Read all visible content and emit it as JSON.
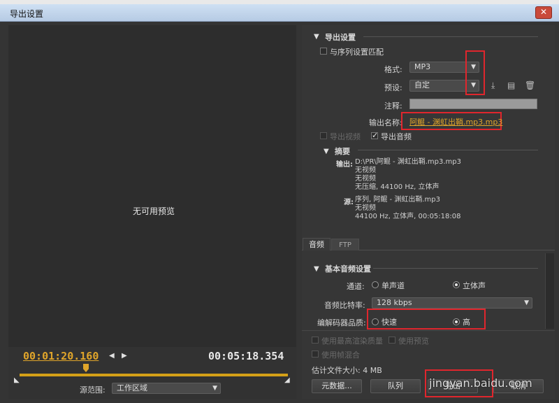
{
  "window": {
    "title": "导出设置",
    "close_glyph": "✕"
  },
  "preview": {
    "no_preview": "无可用预览"
  },
  "timeline": {
    "in_time": "00:01:20.160",
    "out_time": "00:05:18.354",
    "in_pos_fraction": 0.25
  },
  "source_range": {
    "label": "源范围:",
    "value": "工作区域"
  },
  "export": {
    "section_title": "导出设置",
    "match_seq": "与序列设置匹配",
    "format_label": "格式:",
    "format_value": "MP3",
    "preset_label": "预设:",
    "preset_value": "自定",
    "comment_label": "注释:",
    "output_name_label": "输出名称:",
    "output_name_value": "阿鲲 - 渊虹出鞘.mp3.mp3",
    "export_video": "导出视频",
    "export_audio": "导出音频"
  },
  "summary": {
    "title": "摘要",
    "output_label": "输出:",
    "output_lines": [
      "D:\\PR\\阿鲲 - 渊虹出鞘.mp3.mp3",
      "无视频",
      "无视频",
      "无压缩, 44100 Hz, 立体声"
    ],
    "source_label": "源:",
    "source_lines": [
      "序列, 阿鲲 - 渊虹出鞘.mp3",
      "无视频",
      "44100 Hz, 立体声, 00:05:18:08"
    ]
  },
  "tabs": [
    "音频",
    "FTP"
  ],
  "audio": {
    "section_title": "基本音频设置",
    "channel_label": "通道:",
    "mono": "单声道",
    "stereo": "立体声",
    "bitrate_label": "音频比特率:",
    "bitrate_value": "128 kbps",
    "codec_label": "编解码器品质:",
    "fast": "快速",
    "high": "高"
  },
  "options": {
    "max_render": "使用最高渲染质量",
    "use_preview": "使用预览",
    "frame_blend": "使用帧混合",
    "filesize": "估计文件大小: 4 MB"
  },
  "buttons": {
    "metadata": "元数据...",
    "queue": "队列",
    "export": "导出",
    "cancel": "取消"
  },
  "watermark": "jingyan.baidu.com",
  "colors": {
    "accent": "#e0a52a",
    "highlight": "#e0262d"
  }
}
